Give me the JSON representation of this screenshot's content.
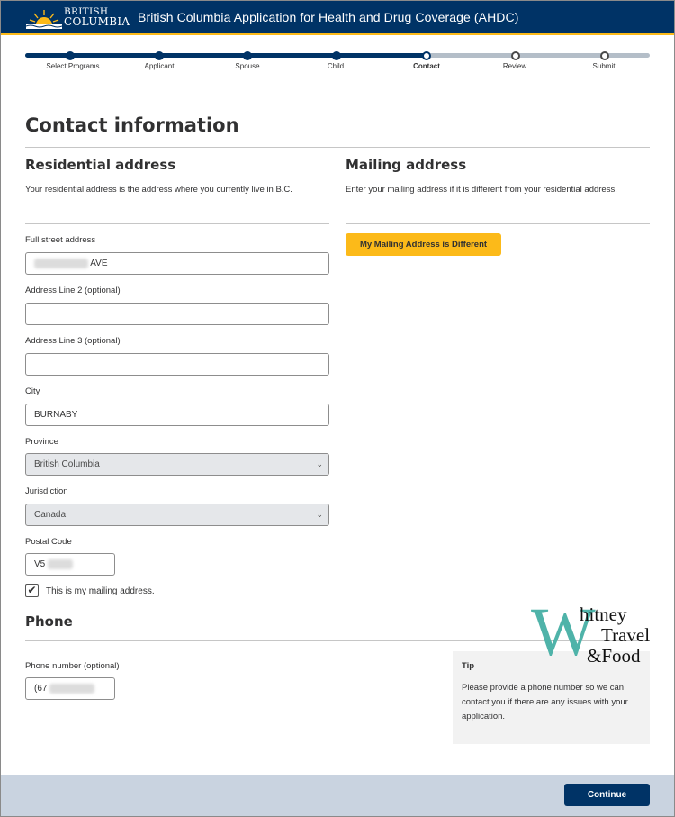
{
  "header": {
    "logo_line1": "BRITISH",
    "logo_line2": "COLUMBIA",
    "title": "British Columbia Application for Health and Drug Coverage (AHDC)"
  },
  "progress": {
    "steps": [
      "Select Programs",
      "Applicant",
      "Spouse",
      "Child",
      "Contact",
      "Review",
      "Submit"
    ],
    "current_step": "Contact"
  },
  "page": {
    "title": "Contact information"
  },
  "residential": {
    "heading": "Residential address",
    "description": "Your residential address is the address where you currently live in B.C.",
    "street_label": "Full street address",
    "street_value": "AVE",
    "line2_label": "Address Line 2 (optional)",
    "line2_value": "",
    "line3_label": "Address Line 3 (optional)",
    "line3_value": "",
    "city_label": "City",
    "city_value": "BURNABY",
    "province_label": "Province",
    "province_value": "British Columbia",
    "jurisdiction_label": "Jurisdiction",
    "jurisdiction_value": "Canada",
    "postal_label": "Postal Code",
    "postal_value": "V5",
    "mailing_checkbox_label": "This is my mailing address.",
    "mailing_checkbox_checked": true
  },
  "mailing": {
    "heading": "Mailing address",
    "description": "Enter your mailing address if it is different from your residential address.",
    "button_label": "My Mailing Address is Different"
  },
  "phone": {
    "heading": "Phone",
    "label": "Phone number (optional)",
    "value": "(67"
  },
  "tip": {
    "title": "Tip",
    "text": "Please provide a phone number so we can contact you if there are any issues with your application."
  },
  "footer": {
    "continue_label": "Continue"
  },
  "watermark": {
    "letter": "W",
    "line1": "hitney",
    "line2": "Travel",
    "line3": "&Food",
    "color": "#4fb3a9"
  },
  "colors": {
    "primary": "#003366",
    "accent": "#fcba19",
    "footer": "#c9d3e0"
  }
}
